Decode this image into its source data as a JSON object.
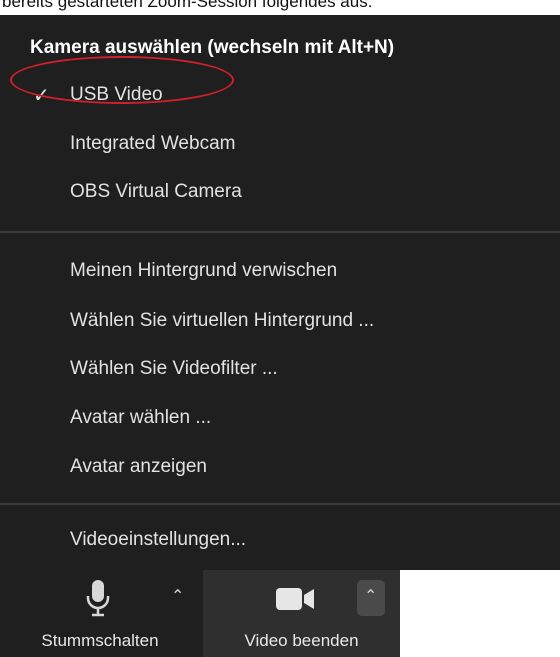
{
  "doc_fragment": "bereits gestarteten Zoom-Session folgendes aus:",
  "menu": {
    "title": "Kamera auswählen (wechseln mit Alt+N)",
    "cameras": [
      {
        "label": "USB Video",
        "checked": true,
        "check_glyph": "✓"
      },
      {
        "label": "Integrated Webcam",
        "checked": false
      },
      {
        "label": "OBS Virtual Camera",
        "checked": false
      }
    ],
    "options": [
      {
        "label": "Meinen Hintergrund verwischen"
      },
      {
        "label": "Wählen Sie virtuellen Hintergrund ..."
      },
      {
        "label": "Wählen Sie Videofilter ..."
      },
      {
        "label": "Avatar wählen ..."
      },
      {
        "label": "Avatar anzeigen"
      }
    ],
    "settings": {
      "label": "Videoeinstellungen..."
    }
  },
  "toolbar": {
    "mute": {
      "label": "Stummschalten",
      "icon": "microphone-icon"
    },
    "video": {
      "label": "Video beenden",
      "icon": "video-camera-icon"
    }
  },
  "colors": {
    "menu_bg": "#1f1f1f",
    "highlight_circle": "#d0202a",
    "active_button_bg": "#2f2f2f"
  }
}
